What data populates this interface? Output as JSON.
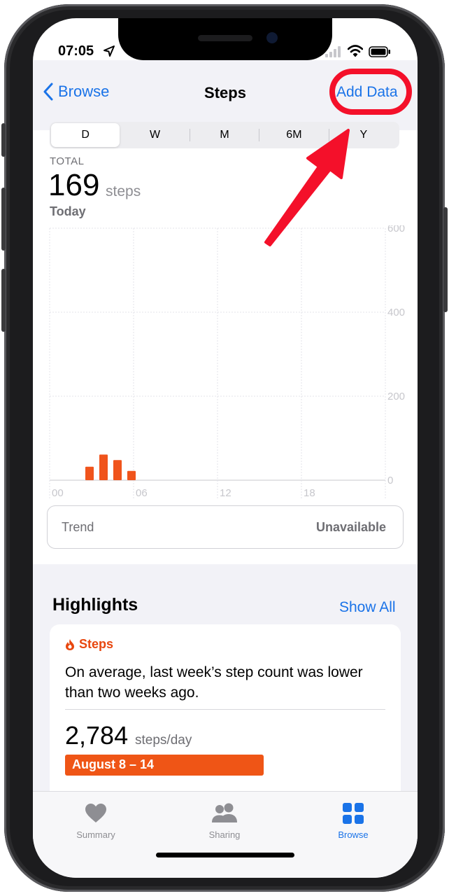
{
  "status_bar": {
    "time": "07:05"
  },
  "nav": {
    "back_label": "Browse",
    "title": "Steps",
    "action_label": "Add Data"
  },
  "segments": [
    "D",
    "W",
    "M",
    "6M",
    "Y"
  ],
  "summary": {
    "total_label": "TOTAL",
    "value": "169",
    "unit": "steps",
    "period": "Today"
  },
  "chart_data": {
    "type": "bar",
    "x_tick_labels": [
      "00",
      "06",
      "12",
      "18"
    ],
    "y_tick_labels": [
      "600",
      "400",
      "200",
      "0"
    ],
    "ylim": [
      0,
      600
    ],
    "xlim_hours": [
      0,
      24
    ],
    "bars": [
      {
        "hour": 3,
        "value": 32
      },
      {
        "hour": 4,
        "value": 61
      },
      {
        "hour": 5,
        "value": 48
      },
      {
        "hour": 6,
        "value": 22
      }
    ],
    "bar_color": "#f0541c",
    "grid": true
  },
  "trend": {
    "label": "Trend",
    "value": "Unavailable"
  },
  "highlights": {
    "title": "Highlights",
    "show_all": "Show All",
    "card": {
      "category": "Steps",
      "text": "On average, last week’s step count was lower than two weeks ago.",
      "number": "2,784",
      "unit": "steps/day",
      "range_label": "August 8 – 14"
    }
  },
  "tabbar": {
    "items": [
      {
        "label": "Summary",
        "icon": "heart-icon",
        "active": false
      },
      {
        "label": "Sharing",
        "icon": "people-icon",
        "active": false
      },
      {
        "label": "Browse",
        "icon": "grid-icon",
        "active": true
      }
    ]
  },
  "colors": {
    "accent": "#1a73e8",
    "orange": "#f0541c",
    "annotation_red": "#f4102a"
  }
}
